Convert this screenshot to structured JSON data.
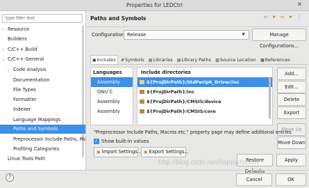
{
  "window": {
    "title": "Properties for LEDCtrl",
    "close_glyph": "✕"
  },
  "sidebar": {
    "filter_placeholder": "type filter text",
    "items": [
      {
        "label": "Resource",
        "arrow": "›"
      },
      {
        "label": "Builders",
        "arrow": ""
      },
      {
        "label": "C/C++ Build",
        "arrow": "›"
      },
      {
        "label": "C/C++ General",
        "arrow": "⌄"
      },
      {
        "label": "Code Analysis",
        "arrow": "›"
      },
      {
        "label": "Documentation",
        "arrow": ""
      },
      {
        "label": "File Types",
        "arrow": ""
      },
      {
        "label": "Formatter",
        "arrow": ""
      },
      {
        "label": "Indexer",
        "arrow": ""
      },
      {
        "label": "Language Mappings",
        "arrow": ""
      },
      {
        "label": "Paths and Symbols",
        "arrow": ""
      },
      {
        "label": "Preprocessor Include Paths, Mac",
        "arrow": ""
      },
      {
        "label": "Profiling Categories",
        "arrow": ""
      },
      {
        "label": "Linux Tools Path",
        "arrow": ""
      }
    ]
  },
  "main": {
    "page_title": "Paths and Symbols",
    "nav_icons": "⇦ ▾ ⇨ ▾ ⋮",
    "configuration_label": "Configuration:",
    "configuration_value": "Release",
    "manage_button": "Manage Configurations...",
    "tabs": [
      {
        "label": "Includes",
        "icon": "▣"
      },
      {
        "label": "Symbols",
        "icon": "#"
      },
      {
        "label": "Libraries",
        "icon": "▤"
      },
      {
        "label": "Library Paths",
        "icon": "▤"
      },
      {
        "label": "Source Location",
        "icon": "▧"
      },
      {
        "label": "References",
        "icon": "▦"
      }
    ],
    "languages_header": "Languages",
    "languages": [
      "Assembly",
      "GNU C",
      "Assembly",
      "Assembly"
    ],
    "include_header": "Include directories",
    "includes": [
      "${ProjDirPath}/StdPeriph_Driver/inc",
      "${ProjDirPath}/inc",
      "${ProjDirPath}/CMSIS/device",
      "${ProjDirPath}/CMSIS/core"
    ],
    "side_buttons": {
      "add": "Add...",
      "edit": "Edit...",
      "delete": "Delete",
      "export": "Export",
      "move_up": "Move Up",
      "move_down": "Move Down"
    },
    "note": "\"Preprocessor Include Paths, Macros etc.\" property page may define additional entries",
    "show_builtin": "Show built-in values",
    "import_button": "Import Settings...",
    "export_button": "Export Settings..."
  },
  "footer": {
    "restore_defaults": "Restore Defaults",
    "apply": "Apply",
    "cancel": "Cancel",
    "ok": "OK",
    "help_glyph": "?",
    "watermark": "http://blog.csdn.net/happydotsun"
  },
  "colors": {
    "selection": "#3d8fe8",
    "folder": "#b58a3a"
  }
}
